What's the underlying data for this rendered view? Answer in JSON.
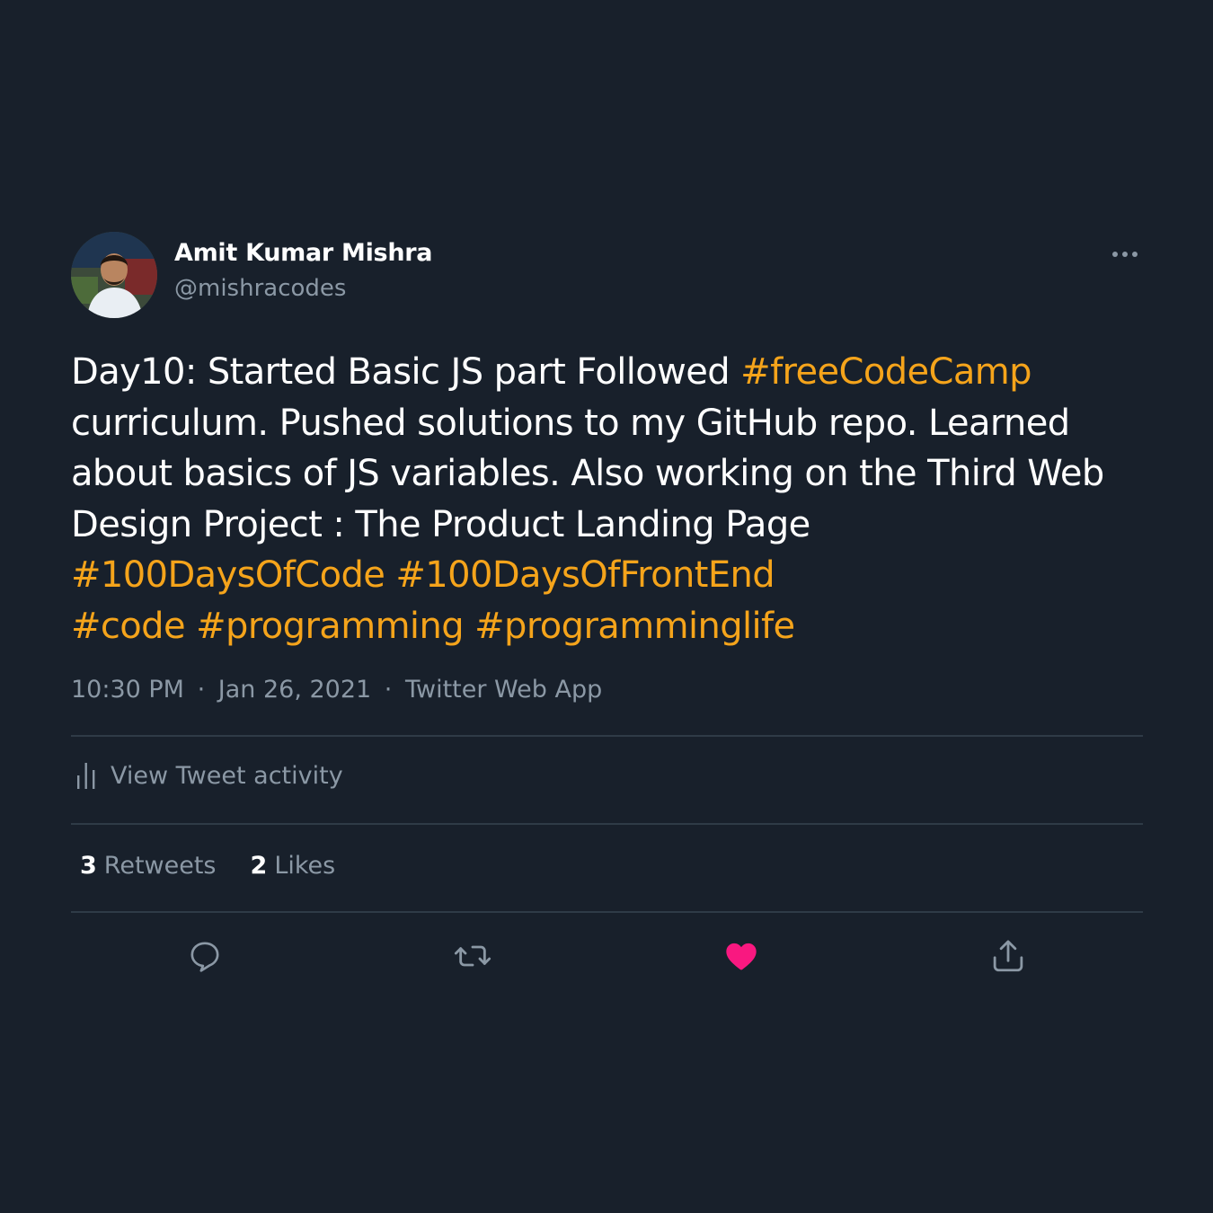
{
  "colors": {
    "background": "#18202b",
    "text": "#ffffff",
    "secondary_text": "#8b98a5",
    "hashtag": "#f5a41b",
    "divider": "#2f3b47",
    "like_active": "#f91880"
  },
  "author": {
    "name": "Amit Kumar Mishra",
    "handle": "@mishracodes",
    "avatar_icon": "profile-photo"
  },
  "more_icon": "more-options-icon",
  "tweet": {
    "lines": [
      [
        {
          "text": "Day10: Started Basic JS part Followed ",
          "hashtag": false
        },
        {
          "text": "#freeCodeCamp",
          "hashtag": true
        }
      ],
      [
        {
          "text": "curriculum. Pushed solutions to my GitHub repo. Learned",
          "hashtag": false
        }
      ],
      [
        {
          "text": "about basics of JS variables. Also working on the Third Web",
          "hashtag": false
        }
      ],
      [
        {
          "text": "Design Project : The Product Landing Page",
          "hashtag": false
        }
      ],
      [
        {
          "text": "#100DaysOfCode",
          "hashtag": true
        },
        {
          "text": " ",
          "hashtag": false
        },
        {
          "text": "#100DaysOfFrontEnd",
          "hashtag": true
        }
      ],
      [
        {
          "text": "#code",
          "hashtag": true
        },
        {
          "text": " ",
          "hashtag": false
        },
        {
          "text": "#programming",
          "hashtag": true
        },
        {
          "text": " ",
          "hashtag": false
        },
        {
          "text": "#programminglife",
          "hashtag": true
        }
      ]
    ]
  },
  "meta": {
    "time": "10:30 PM",
    "separator": "·",
    "date": "Jan 26, 2021",
    "source": "Twitter Web App"
  },
  "activity": {
    "label": "View Tweet activity",
    "icon": "bar-chart-icon"
  },
  "stats": {
    "retweets_count": "3",
    "retweets_label": "Retweets",
    "likes_count": "2",
    "likes_label": "Likes"
  },
  "actions": {
    "reply_icon": "reply-icon",
    "retweet_icon": "retweet-icon",
    "like_icon": "heart-icon",
    "like_active": true,
    "share_icon": "share-icon"
  }
}
